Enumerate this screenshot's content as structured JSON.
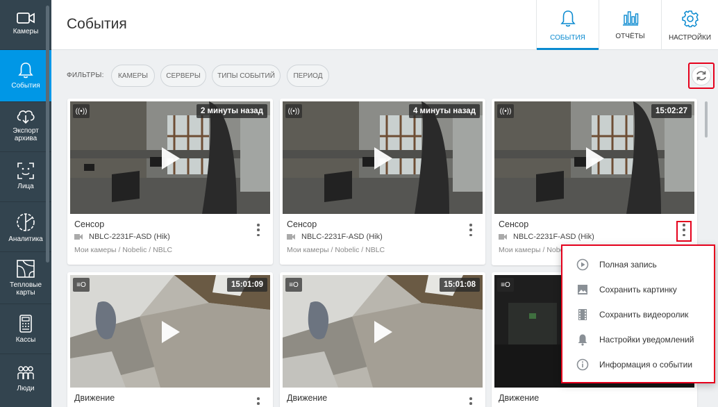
{
  "sidebar": {
    "items": [
      {
        "label": "Камеры",
        "icon": "camera-icon"
      },
      {
        "label": "События",
        "icon": "bell-icon",
        "active": true
      },
      {
        "label": "Экспорт архива",
        "icon": "cloud-download-icon"
      },
      {
        "label": "Лица",
        "icon": "face-scan-icon"
      },
      {
        "label": "Аналитика",
        "icon": "analytics-icon"
      },
      {
        "label": "Тепловые карты",
        "icon": "heatmap-icon"
      },
      {
        "label": "Кассы",
        "icon": "cash-register-icon"
      },
      {
        "label": "Люди",
        "icon": "people-icon"
      }
    ]
  },
  "header": {
    "title": "События",
    "tabs": [
      {
        "label": "СОБЫТИЯ",
        "icon": "bell-icon",
        "active": true
      },
      {
        "label": "ОТЧЁТЫ",
        "icon": "bar-chart-icon"
      },
      {
        "label": "НАСТРОЙКИ",
        "icon": "gear-icon"
      }
    ]
  },
  "filters": {
    "label": "ФИЛЬТРЫ:",
    "chips": [
      "КАМЕРЫ",
      "СЕРВЕРЫ",
      "ТИПЫ СОБЫТИЙ",
      "ПЕРИОД"
    ]
  },
  "events": [
    {
      "title": "Сенсор",
      "time": "2 минуты назад",
      "camera": "NBLC-2231F-ASD (Hik)",
      "path": "Мои камеры / Nobelic / NBLC",
      "type_icon": "sensor-icon",
      "scene": "office"
    },
    {
      "title": "Сенсор",
      "time": "4 минуты назад",
      "camera": "NBLC-2231F-ASD (Hik)",
      "path": "Мои камеры / Nobelic / NBLC",
      "type_icon": "sensor-icon",
      "scene": "office"
    },
    {
      "title": "Сенсор",
      "time": "15:02:27",
      "camera": "NBLC-2231F-ASD (Hik)",
      "path": "Мои камеры / Nobelic / NBLC",
      "type_icon": "sensor-icon",
      "scene": "office"
    },
    {
      "title": "Движение",
      "time": "15:01:09",
      "camera": "",
      "path": "",
      "type_icon": "motion-icon",
      "scene": "room"
    },
    {
      "title": "Движение",
      "time": "15:01:08",
      "camera": "",
      "path": "",
      "type_icon": "motion-icon",
      "scene": "room"
    },
    {
      "title": "Движение",
      "time": "",
      "camera": "",
      "path": "",
      "type_icon": "motion-icon",
      "scene": "dark"
    }
  ],
  "context_menu": {
    "items": [
      {
        "label": "Полная запись",
        "icon": "play-circle-icon"
      },
      {
        "label": "Сохранить картинку",
        "icon": "image-icon"
      },
      {
        "label": "Сохранить видеоролик",
        "icon": "film-icon"
      },
      {
        "label": "Настройки уведомлений",
        "icon": "bell-icon"
      },
      {
        "label": "Информация о событии",
        "icon": "info-icon"
      }
    ]
  },
  "colors": {
    "sidebar": "#33444f",
    "accent": "#0097e6",
    "highlight": "#e5001c"
  }
}
